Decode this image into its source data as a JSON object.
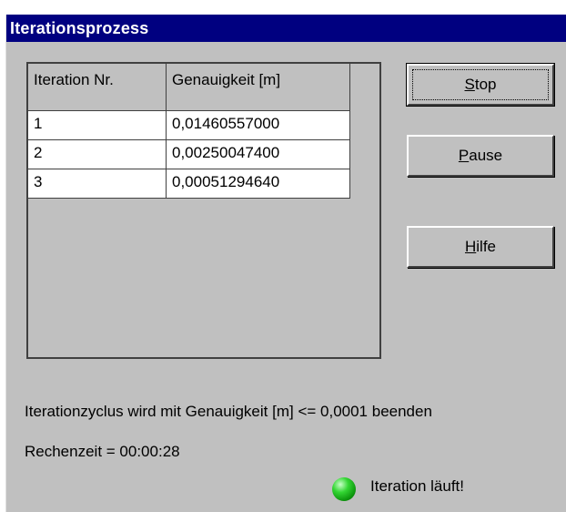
{
  "window": {
    "title": "Iterationsprozess"
  },
  "table": {
    "headers": [
      "Iteration Nr.",
      "Genauigkeit [m]"
    ],
    "rows": [
      [
        "1",
        "0,01460557000"
      ],
      [
        "2",
        "0,00250047400"
      ],
      [
        "3",
        "0,00051294640"
      ]
    ]
  },
  "buttons": {
    "stop": {
      "pre": "",
      "mnemonic": "S",
      "post": "top"
    },
    "pause": {
      "pre": "",
      "mnemonic": "P",
      "post": "ause"
    },
    "hilfe": {
      "pre": "",
      "mnemonic": "H",
      "post": "ilfe"
    }
  },
  "info": {
    "termination": "Iterationzyclus wird mit Genauigkeit [m] <= 0,0001 beenden",
    "runtime": "Rechenzeit = 00:00:28",
    "status": "Iteration läuft!"
  },
  "colors": {
    "titlebar": "#000080",
    "face": "#c0c0c0",
    "status_led": "#22c022"
  },
  "icons": {
    "status": "green-led-icon"
  }
}
